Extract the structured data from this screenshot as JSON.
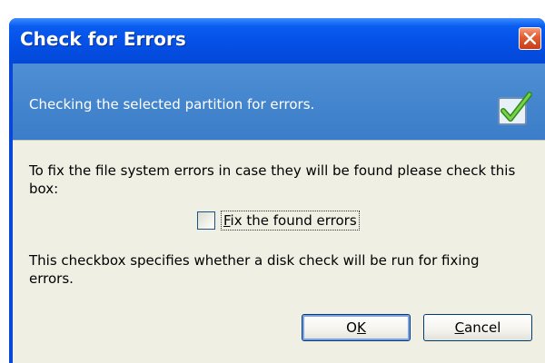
{
  "dialog": {
    "title": "Check for Errors",
    "header_text": "Checking the selected partition for errors.",
    "description": "To fix the file system errors in case they will be found please check this box:",
    "checkbox": {
      "label_mnemonic": "F",
      "label_rest": "ix the found errors",
      "checked": false
    },
    "explanation": "This checkbox specifies whether a disk check will be run for fixing errors.",
    "buttons": {
      "ok_pre": "O",
      "ok_mnemonic": "K",
      "cancel_mnemonic": "C",
      "cancel_rest": "ancel"
    }
  },
  "icons": {
    "close": "close-icon",
    "header": "checkmark-icon"
  },
  "colors": {
    "title_bar": "#0550e6",
    "header_panel": "#3b7dc8",
    "client_bg": "#f0efe4",
    "close_button": "#e25a2f",
    "check_green": "#4caf2a"
  }
}
